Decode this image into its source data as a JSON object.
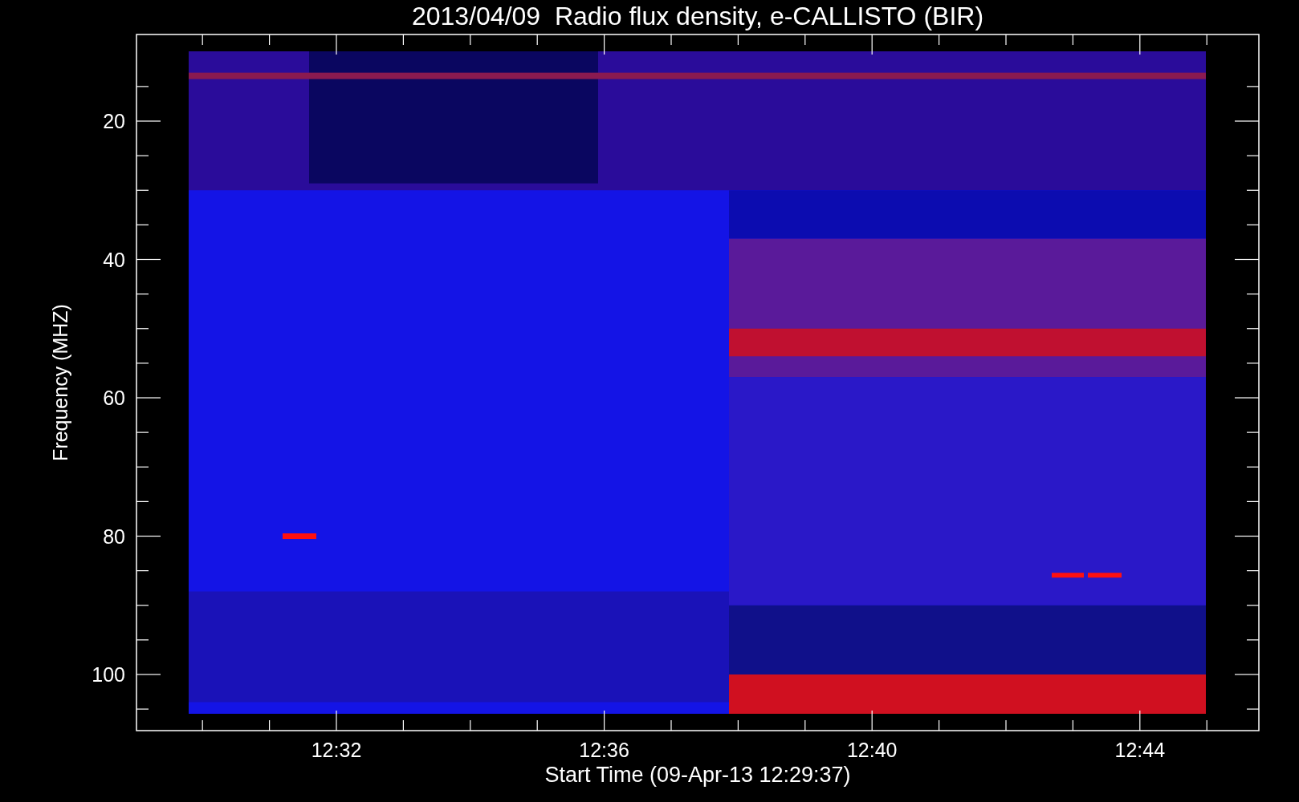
{
  "title": "2013/04/09  Radio flux density, e-CALLISTO (BIR)",
  "y_axis": {
    "label": "Frequency (MHZ)",
    "ticks": [
      "20",
      "40",
      "60",
      "80",
      "100"
    ]
  },
  "x_axis": {
    "label": "Start Time (09-Apr-13 12:29:37)",
    "ticks": [
      "12:32",
      "12:36",
      "12:40",
      "12:44"
    ]
  }
}
